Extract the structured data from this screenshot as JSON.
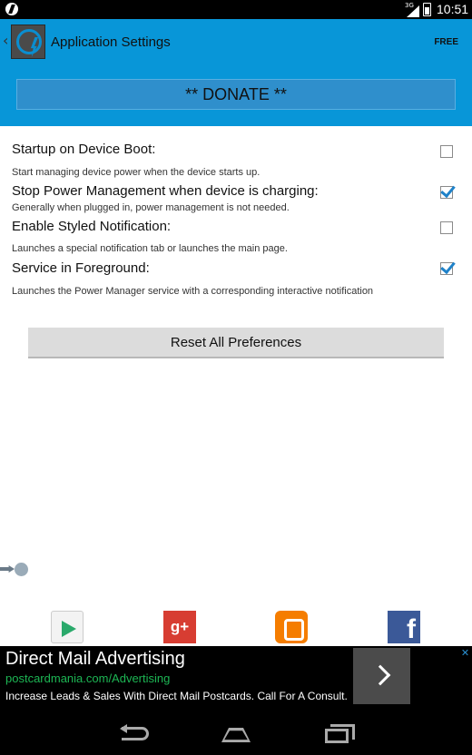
{
  "status_bar": {
    "network": "3G",
    "time": "10:51"
  },
  "header": {
    "title": "Application Settings",
    "badge": "FREE",
    "donate_label": "** DONATE **"
  },
  "preferences": [
    {
      "title": "Startup on Device Boot:",
      "summary": "Start managing device power when the device starts up.",
      "checked": false
    },
    {
      "title": "Stop Power Management when device is charging:",
      "summary": "Generally when plugged in, power management is not needed.",
      "checked": true
    },
    {
      "title": "Enable Styled Notification:",
      "summary": "Launches a special notification tab or launches the main page.",
      "checked": false
    },
    {
      "title": "Service in Foreground:",
      "summary": "Launches the Power Manager service with a corresponding interactive notification",
      "checked": true
    }
  ],
  "reset_label": "Reset All Preferences",
  "social": {
    "gplus_label": "g+",
    "facebook_label": "f"
  },
  "ad": {
    "title": "Direct Mail Advertising",
    "url": "postcardmania.com/Advertising",
    "description": "Increase Leads & Sales With Direct Mail Postcards. Call For A Consult.",
    "close_glyph": "✕"
  },
  "colors": {
    "header_bg": "#0896d8",
    "donate_bg": "#2f8fcc",
    "checkbox_check": "#1f82c9",
    "ad_url": "#1db654"
  },
  "icons": [
    "back-icon",
    "home-icon",
    "recents-icon",
    "play-store-icon",
    "google-plus-icon",
    "blogger-icon",
    "facebook-icon",
    "share-arrow-icon",
    "app-bolt-icon"
  ]
}
